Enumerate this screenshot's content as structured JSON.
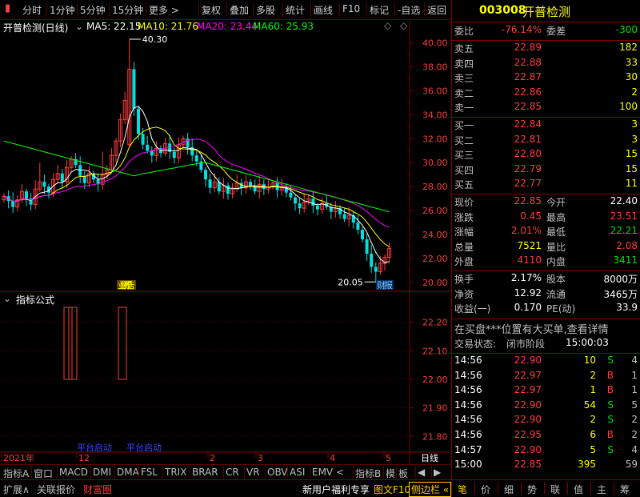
{
  "toolbar": {
    "items": [
      "分时",
      "1分钟",
      "5分钟",
      "15分钟",
      "更多 >",
      "复权",
      "叠加",
      "多股",
      "统计",
      "画线",
      "F10",
      "标记",
      "-自选",
      "返回"
    ]
  },
  "chart": {
    "title": "开普检测(日线)",
    "ma": [
      {
        "label": "MA5: 22.15",
        "color": "#ffffff"
      },
      {
        "label": "MA10: 21.76",
        "color": "#ffff00"
      },
      {
        "label": "MA20: 23.44",
        "color": "#ff00ff"
      },
      {
        "label": "MA60: 25.93",
        "color": "#00ff00"
      }
    ],
    "price_ticks": [
      "40.00",
      "38.00",
      "36.00",
      "34.00",
      "32.00",
      "30.00",
      "28.00",
      "26.00",
      "24.00",
      "22.00",
      "20.00"
    ],
    "high_label": "40.30",
    "low_label": "20.05",
    "events": [
      "业绩预告",
      "业绩快报",
      "财报"
    ],
    "indicator_title": "指标公式",
    "indicator_ticks": [
      "22.20",
      "22.10",
      "22.00",
      "21.90",
      "21.80"
    ],
    "indicator_notes": [
      "平台启动",
      "平台启动"
    ],
    "x_labels": [
      "2021年",
      "12",
      "2",
      "3",
      "4",
      "5"
    ],
    "period": "日线"
  },
  "bottom_tabs": [
    "指标A",
    "窗口",
    "MACD",
    "DMI",
    "DMA",
    "FSL",
    "TRIX",
    "BRAR",
    "CR",
    "VR",
    "OBV",
    "ASI",
    "EMV",
    "<",
    "指标B",
    "模",
    "板",
    "◀",
    "▶"
  ],
  "status_bar": {
    "left": [
      "扩展∧",
      "关联报价",
      "财富圈"
    ],
    "right_text": "新用户福利专享",
    "f10": "图文F10",
    "sidebar": "侧边栏 «",
    "nav": [
      "笔",
      "价",
      "细",
      "势",
      "联",
      "值",
      "主",
      "筹"
    ]
  },
  "quote": {
    "code": "003008",
    "name": "开普检测",
    "weibi_label": "委比",
    "weibi": "-76.14%",
    "weicha_label": "委差",
    "weicha": "-300",
    "sells": [
      {
        "label": "卖五",
        "price": "22.89",
        "vol": "182"
      },
      {
        "label": "卖四",
        "price": "22.88",
        "vol": "33"
      },
      {
        "label": "卖三",
        "price": "22.87",
        "vol": "30"
      },
      {
        "label": "卖二",
        "price": "22.86",
        "vol": "2"
      },
      {
        "label": "卖一",
        "price": "22.85",
        "vol": "100"
      }
    ],
    "buys": [
      {
        "label": "买一",
        "price": "22.84",
        "vol": "3"
      },
      {
        "label": "买二",
        "price": "22.81",
        "vol": "3"
      },
      {
        "label": "买三",
        "price": "22.80",
        "vol": "15"
      },
      {
        "label": "买四",
        "price": "22.79",
        "vol": "15"
      },
      {
        "label": "买五",
        "price": "22.77",
        "vol": "11"
      }
    ],
    "stats": [
      {
        "l1": "现价",
        "v1": "22.85",
        "c1": "red",
        "l2": "今开",
        "v2": "22.40",
        "c2": "white"
      },
      {
        "l1": "涨跌",
        "v1": "0.45",
        "c1": "red",
        "l2": "最高",
        "v2": "23.51",
        "c2": "red"
      },
      {
        "l1": "涨幅",
        "v1": "2.01%",
        "c1": "red",
        "l2": "最低",
        "v2": "22.21",
        "c2": "green"
      },
      {
        "l1": "总量",
        "v1": "7521",
        "c1": "yellow",
        "l2": "量比",
        "v2": "2.08",
        "c2": "red"
      },
      {
        "l1": "外盘",
        "v1": "4110",
        "c1": "red",
        "l2": "内盘",
        "v2": "3411",
        "c2": "green"
      }
    ],
    "fin": [
      {
        "l1": "换手",
        "v1": "2.17%",
        "l2": "股本",
        "v2": "8000万"
      },
      {
        "l1": "净资",
        "v1": "12.92",
        "l2": "流通",
        "v2": "3465万"
      },
      {
        "l1": "收益(一)",
        "v1": "0.170",
        "l2": "PE(动)",
        "v2": "33.9"
      }
    ],
    "notice": "在买盘***位置有大买单,查看详情",
    "trade_status_label": "交易状态:",
    "trade_status": "闭市阶段",
    "trade_time": "15:00:03",
    "ticks": [
      {
        "t": "14:56",
        "p": "22.90",
        "v": "10",
        "s": "S",
        "n": "4"
      },
      {
        "t": "14:56",
        "p": "22.97",
        "v": "2",
        "s": "B",
        "n": "1"
      },
      {
        "t": "14:56",
        "p": "22.97",
        "v": "1",
        "s": "B",
        "n": "1"
      },
      {
        "t": "14:56",
        "p": "22.90",
        "v": "54",
        "s": "S",
        "n": "5"
      },
      {
        "t": "14:56",
        "p": "22.90",
        "v": "2",
        "s": "S",
        "n": "2"
      },
      {
        "t": "14:56",
        "p": "22.95",
        "v": "6",
        "s": "B",
        "n": "2"
      },
      {
        "t": "14:57",
        "p": "22.90",
        "v": "5",
        "s": "S",
        "n": "4"
      },
      {
        "t": "15:00",
        "p": "22.85",
        "v": "395",
        "s": "",
        "n": "59"
      }
    ]
  },
  "colors": {
    "up": "#ff3b3b",
    "down": "#00e0e0",
    "grid": "#800000",
    "ma5": "#ffffff",
    "ma10": "#ffff00",
    "ma20": "#ff00ff",
    "ma60": "#00ff00"
  }
}
